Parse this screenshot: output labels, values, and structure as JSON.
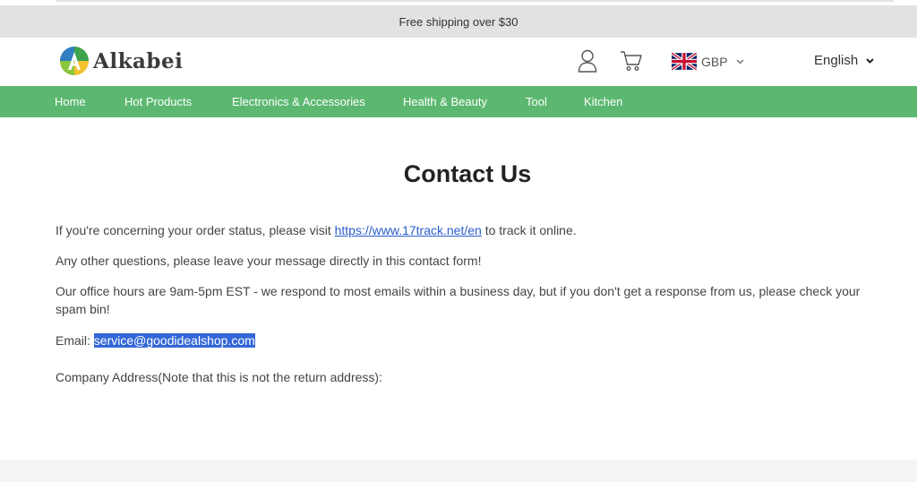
{
  "announcement": "Free shipping over $30",
  "header": {
    "logo_text": "Alkabei",
    "currency": "GBP",
    "language": "English"
  },
  "nav": {
    "items": [
      {
        "label": "Home"
      },
      {
        "label": "Hot Products"
      },
      {
        "label": "Electronics & Accessories"
      },
      {
        "label": "Health & Beauty"
      },
      {
        "label": "Tool"
      },
      {
        "label": "Kitchen"
      }
    ]
  },
  "content": {
    "title": "Contact Us",
    "order_status_prefix": "If you're concerning your order status, please visit ",
    "order_status_link": "https://www.17track.net/en",
    "order_status_suffix": " to track it online.",
    "other_questions": "Any other questions, please leave your message directly in this contact form!",
    "office_hours": "Our office hours are 9am-5pm EST - we respond to most emails within a business day, but if you don't get a response from us, please check your spam bin!",
    "email_label": "Email: ",
    "email_value": "service@goodidealshop.com",
    "company_address": "Company Address(Note that this is not the return address):"
  },
  "colors": {
    "nav_green": "#5cb870",
    "announcement_bg": "#e2e2e2",
    "link_blue": "#2a5dcc",
    "selection_blue": "#3367d6"
  },
  "icons": {
    "account": "user-icon",
    "cart": "cart-icon",
    "flag": "uk-flag-icon",
    "dropdown": "chevron-down-icon"
  }
}
